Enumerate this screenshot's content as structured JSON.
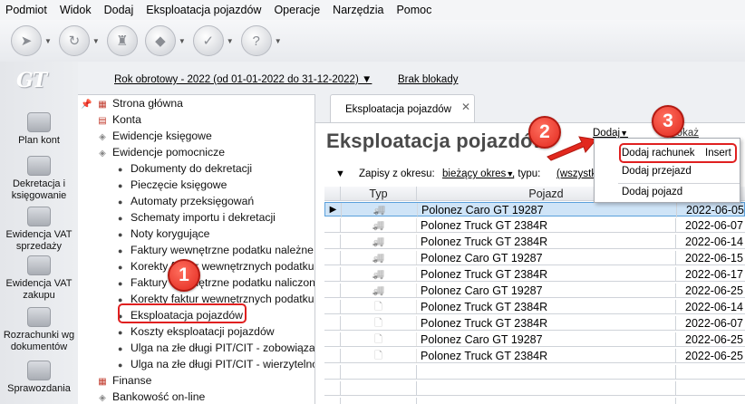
{
  "menubar": [
    "Podmiot",
    "Widok",
    "Dodaj",
    "Eksploatacja pojazdów",
    "Operacje",
    "Narzędzia",
    "Pomoc"
  ],
  "toolbar": {
    "icons": [
      "navigate-icon",
      "refresh-icon",
      "stamp-icon",
      "tag-icon",
      "check-document-icon",
      "help-icon"
    ]
  },
  "logo": "GT",
  "app_sidebar": [
    {
      "label": "Plan kont"
    },
    {
      "label": "Dekretacja i księgowanie"
    },
    {
      "label": "Ewidencja VAT sprzedaży"
    },
    {
      "label": "Ewidencja VAT zakupu"
    },
    {
      "label": "Rozrachunki wg dokumentów"
    },
    {
      "label": "Sprawozdania"
    }
  ],
  "infobar": {
    "rok": "Rok obrotowy - 2022  (od 01-01-2022 do 31-12-2022)",
    "blokada": "Brak blokady"
  },
  "tree": {
    "top": [
      {
        "label": "Strona główna",
        "icon_color": "#c0392b"
      },
      {
        "label": "Konta",
        "icon_color": "#c0392b"
      },
      {
        "label": "Ewidencje księgowe",
        "icon_color": "#888888"
      },
      {
        "label": "Ewidencje pomocnicze",
        "icon_color": "#888888"
      }
    ],
    "children": [
      "Dokumenty do dekretacji",
      "Pieczęcie księgowe",
      "Automaty przeksięgowań",
      "Schematy importu i dekretacji",
      "Noty korygujące",
      "Faktury wewnętrzne podatku należne",
      "Korekty faktur wewnętrznych podatku",
      "Faktury wewnętrzne podatku naliczon",
      "Korekty faktur wewnętrznych podatku",
      "Eksploatacja pojazdów",
      "Koszty eksploatacji pojazdów",
      "Ulga na złe długi PIT/CIT - zobowiąza",
      "Ulga na złe długi PIT/CIT - wierzytelno"
    ],
    "bottom": [
      {
        "label": "Finanse",
        "icon_color": "#c0392b"
      },
      {
        "label": "Bankowość on-line",
        "icon_color": "#888888"
      }
    ]
  },
  "tab": {
    "label": "Eksploatacja pojazdów",
    "close": "✕"
  },
  "page_title": "Eksploatacja pojazdów",
  "actions": {
    "dodaj": "Dodaj",
    "pokaz": "Pokaż"
  },
  "filter": {
    "label1": "Zapisy z okresu:",
    "value1": "bieżący okres",
    "label2": ", typu:",
    "value2": "(wszystk"
  },
  "grid": {
    "headers": [
      "Typ",
      "Pojazd"
    ],
    "rows": [
      {
        "typ": "truck",
        "pojazd": "Polonez Caro GT 19287",
        "date": "2022-06-05",
        "selected": true
      },
      {
        "typ": "truck",
        "pojazd": "Polonez Truck GT 2384R",
        "date": "2022-06-07"
      },
      {
        "typ": "truck",
        "pojazd": "Polonez Truck GT 2384R",
        "date": "2022-06-14"
      },
      {
        "typ": "truck",
        "pojazd": "Polonez Caro GT 19287",
        "date": "2022-06-15"
      },
      {
        "typ": "truck",
        "pojazd": "Polonez Truck GT 2384R",
        "date": "2022-06-17"
      },
      {
        "typ": "truck",
        "pojazd": "Polonez Caro GT 19287",
        "date": "2022-06-25"
      },
      {
        "typ": "doc",
        "pojazd": "Polonez Truck GT 2384R",
        "date": "2022-06-14"
      },
      {
        "typ": "doc",
        "pojazd": "Polonez Truck GT 2384R",
        "date": "2022-06-07"
      },
      {
        "typ": "doc",
        "pojazd": "Polonez Caro GT 19287",
        "date": "2022-06-25"
      },
      {
        "typ": "doc",
        "pojazd": "Polonez Truck GT 2384R",
        "date": "2022-06-25"
      }
    ]
  },
  "dropdown": {
    "item1": "Dodaj rachunek",
    "item1_shortcut": "Insert",
    "item2": "Dodaj przejazd",
    "item3": "Dodaj pojazd"
  },
  "badges": [
    "1",
    "2",
    "3"
  ],
  "colors": {
    "badge": "#e2281e",
    "highlight": "#e02020",
    "selection": "#cfe4f7"
  }
}
